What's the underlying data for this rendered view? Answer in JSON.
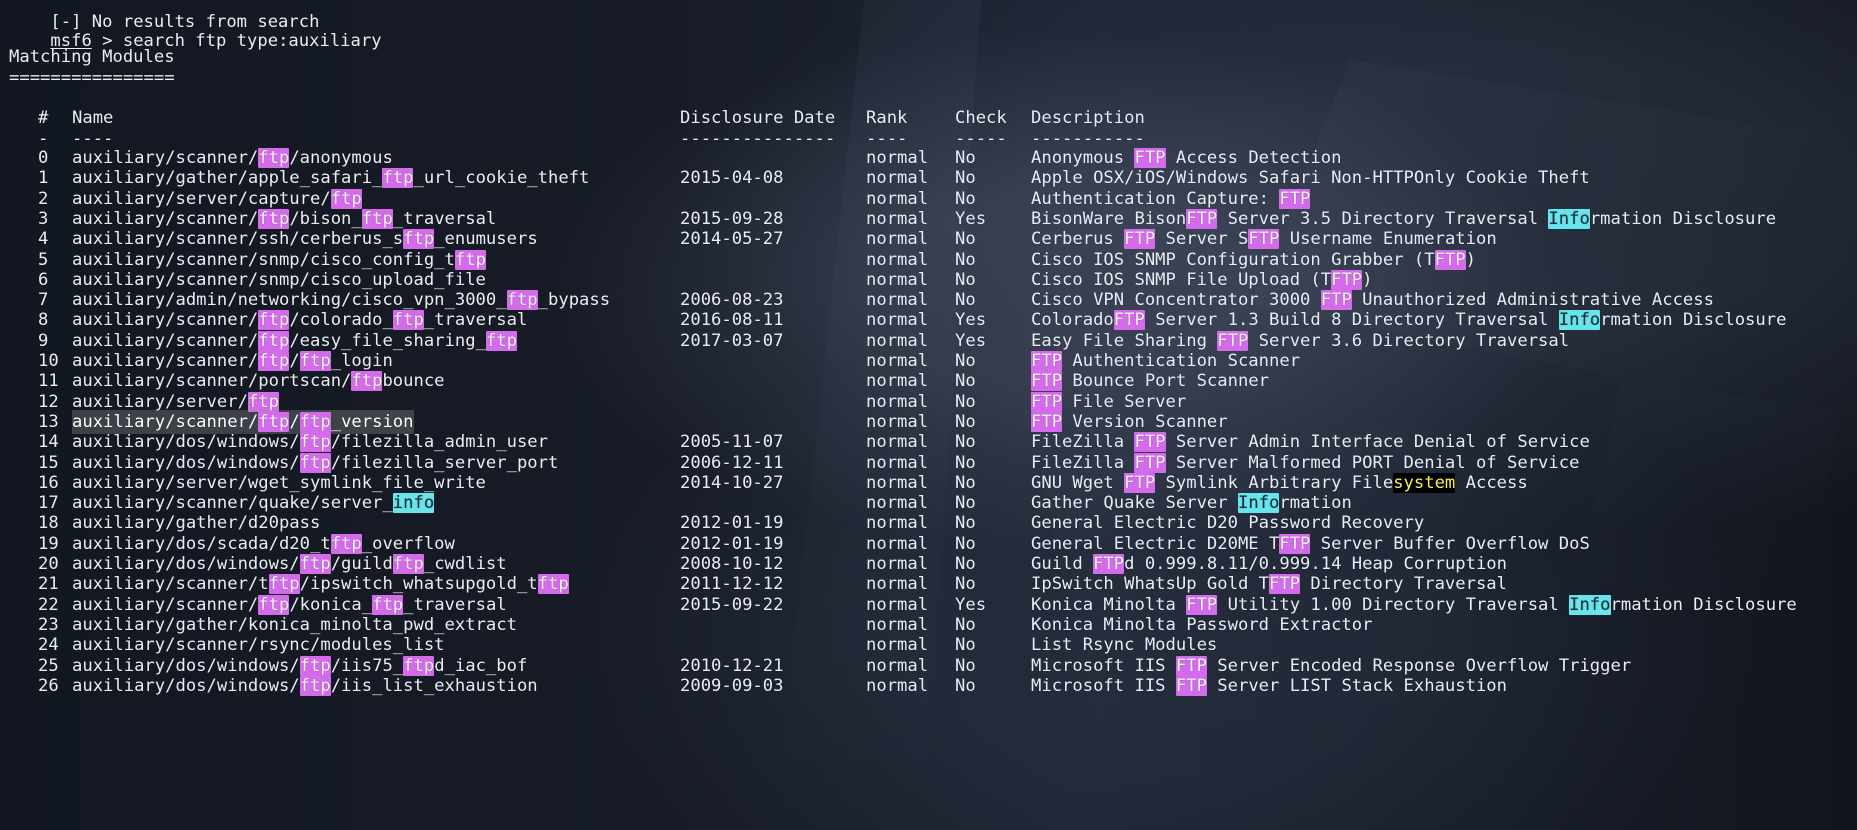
{
  "terminal": {
    "previous_line": "[-] No results from search",
    "prompt": {
      "label": "msf6",
      "separator": " > ",
      "command": "search ftp type:auxiliary"
    },
    "heading": "Matching Modules",
    "heading_rule": "================",
    "columns": {
      "index": "#",
      "name": "Name",
      "date": "Disclosure Date",
      "rank": "Rank",
      "check": "Check",
      "description": "Description"
    },
    "column_rules": {
      "index": "-",
      "name": "----",
      "date": "---------------",
      "rank": "----",
      "check": "-----",
      "description": "-----------"
    },
    "rows": [
      {
        "index": "0",
        "name": "auxiliary/scanner/ftp/anonymous",
        "date": "",
        "rank": "normal",
        "check": "No",
        "description": "Anonymous FTP Access Detection"
      },
      {
        "index": "1",
        "name": "auxiliary/gather/apple_safari_ftp_url_cookie_theft",
        "date": "2015-04-08",
        "rank": "normal",
        "check": "No",
        "description": "Apple OSX/iOS/Windows Safari Non-HTTPOnly Cookie Theft"
      },
      {
        "index": "2",
        "name": "auxiliary/server/capture/ftp",
        "date": "",
        "rank": "normal",
        "check": "No",
        "description": "Authentication Capture: FTP"
      },
      {
        "index": "3",
        "name": "auxiliary/scanner/ftp/bison_ftp_traversal",
        "date": "2015-09-28",
        "rank": "normal",
        "check": "Yes",
        "description": "BisonWare BisonFTP Server 3.5 Directory Traversal Information Disclosure"
      },
      {
        "index": "4",
        "name": "auxiliary/scanner/ssh/cerberus_sftp_enumusers",
        "date": "2014-05-27",
        "rank": "normal",
        "check": "No",
        "description": "Cerberus FTP Server SFTP Username Enumeration"
      },
      {
        "index": "5",
        "name": "auxiliary/scanner/snmp/cisco_config_tftp",
        "date": "",
        "rank": "normal",
        "check": "No",
        "description": "Cisco IOS SNMP Configuration Grabber (TFTP)"
      },
      {
        "index": "6",
        "name": "auxiliary/scanner/snmp/cisco_upload_file",
        "date": "",
        "rank": "normal",
        "check": "No",
        "description": "Cisco IOS SNMP File Upload (TFTP)"
      },
      {
        "index": "7",
        "name": "auxiliary/admin/networking/cisco_vpn_3000_ftp_bypass",
        "date": "2006-08-23",
        "rank": "normal",
        "check": "No",
        "description": "Cisco VPN Concentrator 3000 FTP Unauthorized Administrative Access"
      },
      {
        "index": "8",
        "name": "auxiliary/scanner/ftp/colorado_ftp_traversal",
        "date": "2016-08-11",
        "rank": "normal",
        "check": "Yes",
        "description": "ColoradoFTP Server 1.3 Build 8 Directory Traversal Information Disclosure"
      },
      {
        "index": "9",
        "name": "auxiliary/scanner/ftp/easy_file_sharing_ftp",
        "date": "2017-03-07",
        "rank": "normal",
        "check": "Yes",
        "description": "Easy File Sharing FTP Server 3.6 Directory Traversal"
      },
      {
        "index": "10",
        "name": "auxiliary/scanner/ftp/ftp_login",
        "date": "",
        "rank": "normal",
        "check": "No",
        "description": "FTP Authentication Scanner"
      },
      {
        "index": "11",
        "name": "auxiliary/scanner/portscan/ftpbounce",
        "date": "",
        "rank": "normal",
        "check": "No",
        "description": "FTP Bounce Port Scanner"
      },
      {
        "index": "12",
        "name": "auxiliary/server/ftp",
        "date": "",
        "rank": "normal",
        "check": "No",
        "description": "FTP File Server"
      },
      {
        "index": "13",
        "name": "auxiliary/scanner/ftp/ftp_version",
        "date": "",
        "rank": "normal",
        "check": "No",
        "description": "FTP Version Scanner"
      },
      {
        "index": "14",
        "name": "auxiliary/dos/windows/ftp/filezilla_admin_user",
        "date": "2005-11-07",
        "rank": "normal",
        "check": "No",
        "description": "FileZilla FTP Server Admin Interface Denial of Service"
      },
      {
        "index": "15",
        "name": "auxiliary/dos/windows/ftp/filezilla_server_port",
        "date": "2006-12-11",
        "rank": "normal",
        "check": "No",
        "description": "FileZilla FTP Server Malformed PORT Denial of Service"
      },
      {
        "index": "16",
        "name": "auxiliary/server/wget_symlink_file_write",
        "date": "2014-10-27",
        "rank": "normal",
        "check": "No",
        "description": "GNU Wget FTP Symlink Arbitrary Filesystem Access"
      },
      {
        "index": "17",
        "name": "auxiliary/scanner/quake/server_info",
        "date": "",
        "rank": "normal",
        "check": "No",
        "description": "Gather Quake Server Information"
      },
      {
        "index": "18",
        "name": "auxiliary/gather/d20pass",
        "date": "2012-01-19",
        "rank": "normal",
        "check": "No",
        "description": "General Electric D20 Password Recovery"
      },
      {
        "index": "19",
        "name": "auxiliary/dos/scada/d20_tftp_overflow",
        "date": "2012-01-19",
        "rank": "normal",
        "check": "No",
        "description": "General Electric D20ME TFTP Server Buffer Overflow DoS"
      },
      {
        "index": "20",
        "name": "auxiliary/dos/windows/ftp/guildftp_cwdlist",
        "date": "2008-10-12",
        "rank": "normal",
        "check": "No",
        "description": "Guild FTPd 0.999.8.11/0.999.14 Heap Corruption"
      },
      {
        "index": "21",
        "name": "auxiliary/scanner/tftp/ipswitch_whatsupgold_tftp",
        "date": "2011-12-12",
        "rank": "normal",
        "check": "No",
        "description": "IpSwitch WhatsUp Gold TFTP Directory Traversal"
      },
      {
        "index": "22",
        "name": "auxiliary/scanner/ftp/konica_ftp_traversal",
        "date": "2015-09-22",
        "rank": "normal",
        "check": "Yes",
        "description": "Konica Minolta FTP Utility 1.00 Directory Traversal Information Disclosure"
      },
      {
        "index": "23",
        "name": "auxiliary/gather/konica_minolta_pwd_extract",
        "date": "",
        "rank": "normal",
        "check": "No",
        "description": "Konica Minolta Password Extractor"
      },
      {
        "index": "24",
        "name": "auxiliary/scanner/rsync/modules_list",
        "date": "",
        "rank": "normal",
        "check": "No",
        "description": "List Rsync Modules"
      },
      {
        "index": "25",
        "name": "auxiliary/dos/windows/ftp/iis75_ftpd_iac_bof",
        "date": "2010-12-21",
        "rank": "normal",
        "check": "No",
        "description": "Microsoft IIS FTP Server Encoded Response Overflow Trigger"
      },
      {
        "index": "26",
        "name": "auxiliary/dos/windows/ftp/iis_list_exhaustion",
        "date": "2009-09-03",
        "rank": "normal",
        "check": "No",
        "description": "Microsoft IIS FTP Server LIST Stack Exhaustion"
      }
    ]
  },
  "colors": {
    "text": "#e9edf4",
    "ftp_highlight": "#d36bea",
    "info_highlight": "#67e4ec",
    "system_highlight_bg": "#000000",
    "system_highlight_fg": "#f6f04f",
    "selected_row": "#7f7f7f"
  }
}
